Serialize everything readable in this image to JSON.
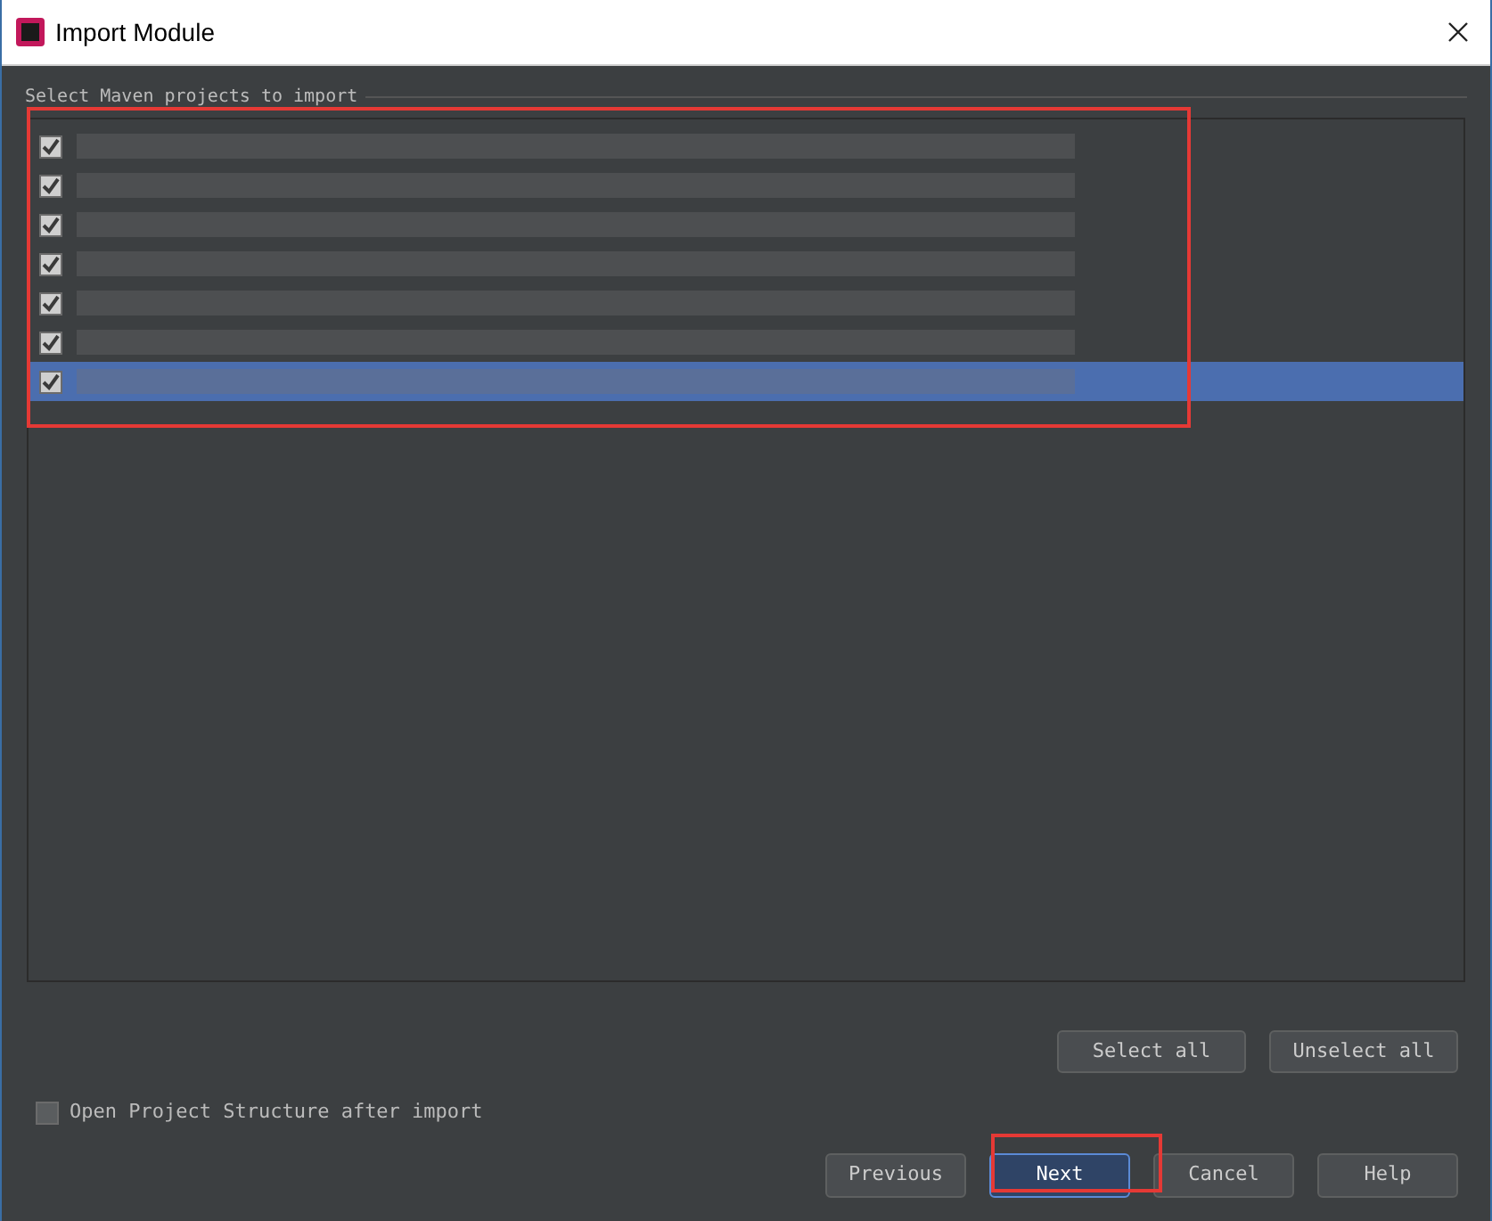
{
  "window": {
    "title": "Import Module"
  },
  "group_label": "Select Maven projects to import",
  "projects": [
    {
      "checked": true,
      "selected": false
    },
    {
      "checked": true,
      "selected": false
    },
    {
      "checked": true,
      "selected": false
    },
    {
      "checked": true,
      "selected": false
    },
    {
      "checked": true,
      "selected": false
    },
    {
      "checked": true,
      "selected": false
    },
    {
      "checked": true,
      "selected": true
    }
  ],
  "list_buttons": [
    "Select all",
    "Unselect all"
  ],
  "open_structure": {
    "label": "Open Project Structure after import",
    "checked": false
  },
  "nav_buttons": [
    {
      "label": "Previous",
      "default": false
    },
    {
      "label": "Next",
      "default": true
    },
    {
      "label": "Cancel",
      "default": false
    },
    {
      "label": "Help",
      "default": false
    }
  ]
}
